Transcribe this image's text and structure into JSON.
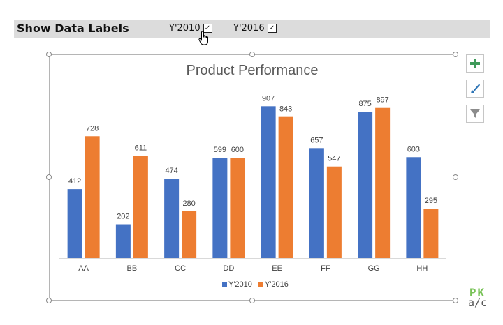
{
  "header": {
    "title": "Show Data Labels",
    "checkbox_2010": {
      "label": "Y'2010",
      "checked": true
    },
    "checkbox_2016": {
      "label": "Y'2016",
      "checked": true
    }
  },
  "colors": {
    "series_2010": "#4472c4",
    "series_2016": "#ed7d31",
    "axis": "#d9d9d9",
    "label": "#404040"
  },
  "side_buttons": [
    "plus-icon",
    "brush-icon",
    "filter-icon"
  ],
  "logo": {
    "line1": "PK",
    "line2": "a/c"
  },
  "chart_data": {
    "type": "bar",
    "title": "Product Performance",
    "categories": [
      "AA",
      "BB",
      "CC",
      "DD",
      "EE",
      "FF",
      "GG",
      "HH"
    ],
    "series": [
      {
        "name": "Y'2010",
        "values": [
          412,
          202,
          474,
          599,
          907,
          657,
          875,
          603
        ]
      },
      {
        "name": "Y'2016",
        "values": [
          728,
          611,
          280,
          600,
          843,
          547,
          897,
          295
        ]
      }
    ],
    "ylim": [
      0,
      1000
    ],
    "grid": false,
    "legend": "bottom",
    "data_labels": true
  }
}
